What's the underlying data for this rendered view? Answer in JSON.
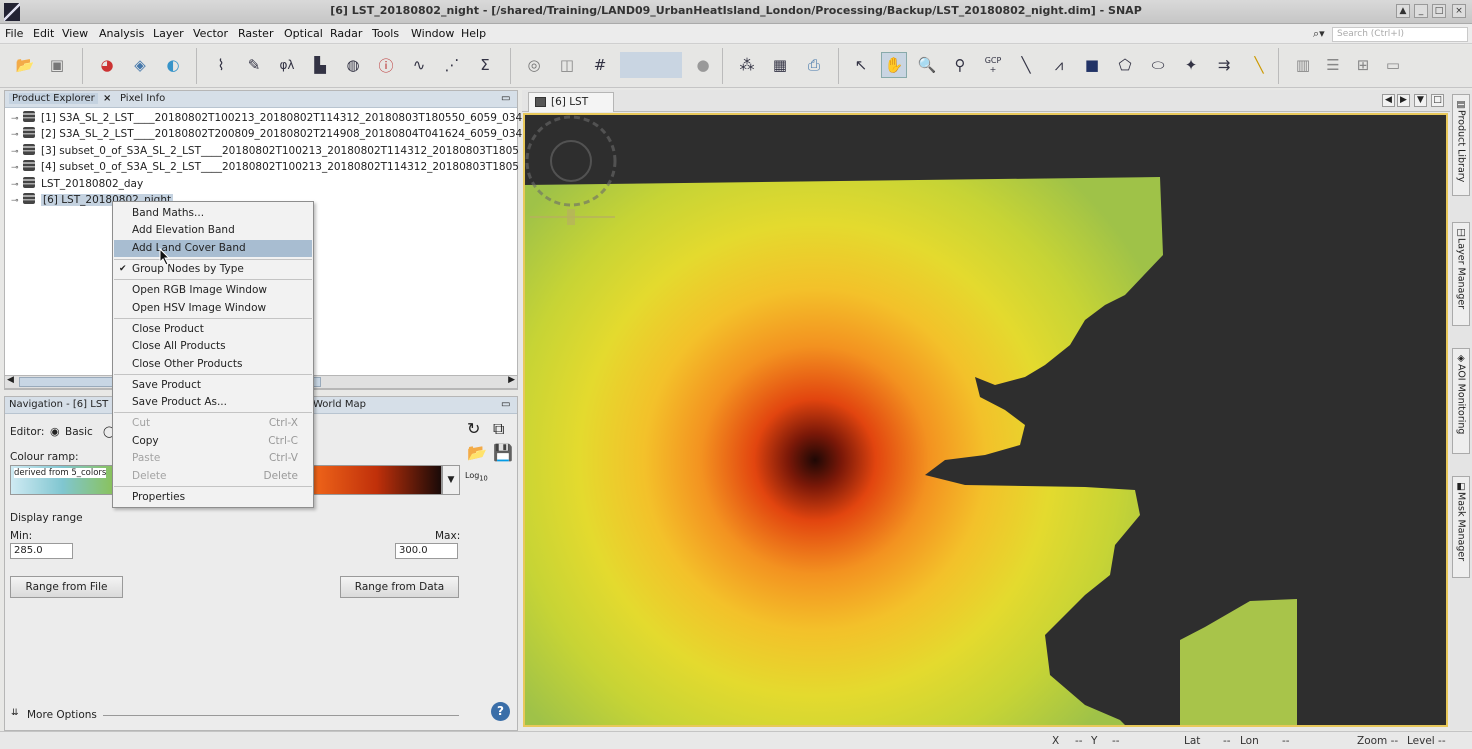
{
  "window": {
    "title": "[6] LST_20180802_night - [/shared/Training/LAND09_UrbanHeatIsland_London/Processing/Backup/LST_20180802_night.dim] - SNAP"
  },
  "menu": [
    "File",
    "Edit",
    "View",
    "Analysis",
    "Layer",
    "Vector",
    "Raster",
    "Optical",
    "Radar",
    "Tools",
    "Window",
    "Help"
  ],
  "search": {
    "placeholder": "Search (Ctrl+I)"
  },
  "toolbar": {
    "gcp_label": "GCP"
  },
  "product_explorer": {
    "tabs": [
      "Product Explorer",
      "Pixel Info"
    ],
    "products": [
      "[1] S3A_SL_2_LST____20180802T100213_20180802T114312_20180803T180550_6059_034",
      "[2] S3A_SL_2_LST____20180802T200809_20180802T214908_20180804T041624_6059_034",
      "[3] subset_0_of_S3A_SL_2_LST____20180802T100213_20180802T114312_20180803T1805",
      "[4] subset_0_of_S3A_SL_2_LST____20180802T100213_20180802T114312_20180803T1805",
      "LST_20180802_day",
      "[6] LST_20180802_night"
    ]
  },
  "context_menu": {
    "items": [
      {
        "label": "Band Maths..."
      },
      {
        "label": "Add Elevation Band"
      },
      {
        "label": "Add Land Cover Band",
        "highlighted": true
      },
      {
        "label": "Group Nodes by Type",
        "checked": true
      },
      {
        "label": "Open RGB Image Window"
      },
      {
        "label": "Open HSV Image Window"
      },
      {
        "label": "Close Product"
      },
      {
        "label": "Close All Products"
      },
      {
        "label": "Close Other Products"
      },
      {
        "label": "Save Product"
      },
      {
        "label": "Save Product As..."
      },
      {
        "label": "Cut",
        "shortcut": "Ctrl-X",
        "disabled": true
      },
      {
        "label": "Copy",
        "shortcut": "Ctrl-C"
      },
      {
        "label": "Paste",
        "shortcut": "Ctrl-V",
        "disabled": true
      },
      {
        "label": "Delete",
        "shortcut": "Delete",
        "disabled": true
      },
      {
        "label": "Properties"
      }
    ]
  },
  "navigation": {
    "tab1": "Navigation - [6] LST",
    "tab2": "World Map",
    "editor_label": "Editor:",
    "editor_basic": "Basic",
    "colour_ramp_label": "Colour ramp:",
    "ramp_name": "derived from 5_colors",
    "log_label": "Log",
    "log_sub": "10",
    "display_range_label": "Display range",
    "min_label": "Min:",
    "max_label": "Max:",
    "min_value": "285.0",
    "max_value": "300.0",
    "range_from_file": "Range from File",
    "range_from_data": "Range from Data",
    "more_options": "More Options",
    "help_glyph": "?"
  },
  "image_window": {
    "tab_label": "[6] LST"
  },
  "side_panels": [
    "Product Library",
    "Layer Manager",
    "AOI Monitoring",
    "Mask Manager"
  ],
  "status": {
    "x_label": "X",
    "x_val": "--",
    "y_label": "Y",
    "y_val": "--",
    "lat_label": "Lat",
    "lat_val": "--",
    "lon_label": "Lon",
    "lon_val": "--",
    "zoom_label": "Zoom --",
    "level_label": "Level --"
  },
  "colors": {
    "accent": "#a8bdd1",
    "view_border": "#e8c85a",
    "panel_header": "#d6dfe8"
  }
}
